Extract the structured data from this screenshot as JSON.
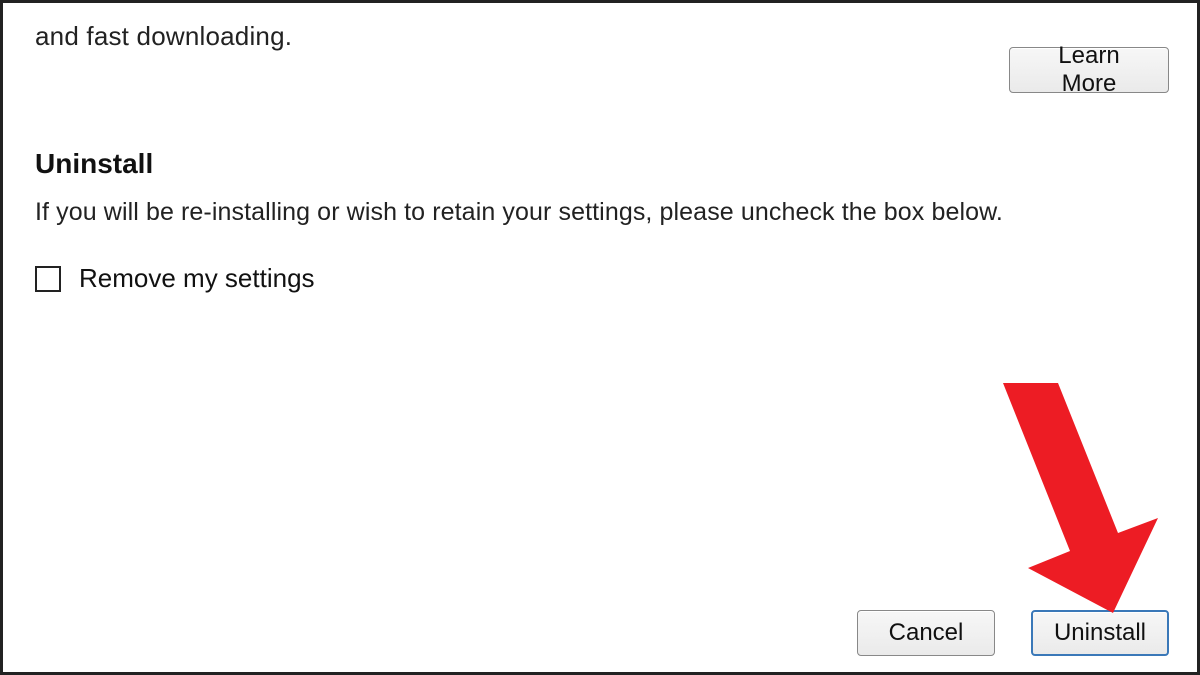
{
  "header": {
    "top_fragment": "and fast downloading.",
    "learn_more_label": "Learn More"
  },
  "uninstall_section": {
    "heading": "Uninstall",
    "instruction": "If you will be re-installing or wish to retain your settings, please uncheck the box below.",
    "checkbox_label": "Remove my settings",
    "checkbox_checked": false
  },
  "buttons": {
    "cancel_label": "Cancel",
    "uninstall_label": "Uninstall"
  },
  "annotation": {
    "arrow_target": "uninstall-button",
    "arrow_color": "#ed1c24"
  }
}
